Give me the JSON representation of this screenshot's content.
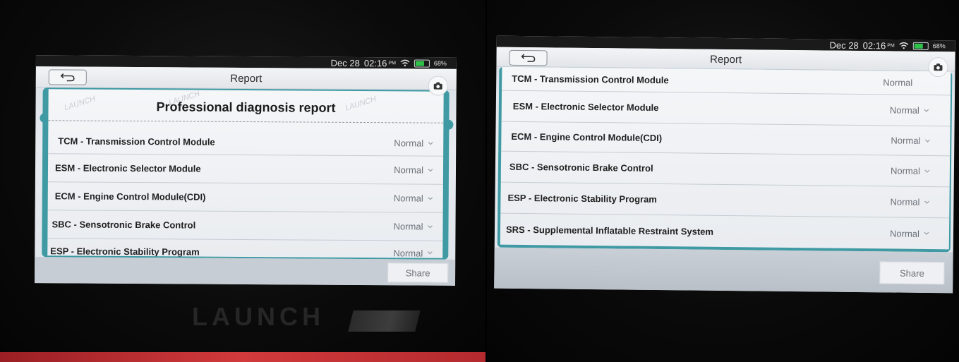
{
  "status": {
    "date": "Dec 28",
    "time": "02:16",
    "ampm": "PM",
    "battery": "68%"
  },
  "screen_title": "Report",
  "report_heading": "Professional diagnosis report",
  "watermark": "LAUNCH",
  "device_brand": "LAUNCH",
  "modules": [
    {
      "name": "TCM - Transmission Control Module",
      "status": "Normal"
    },
    {
      "name": "ESM - Electronic Selector Module",
      "status": "Normal"
    },
    {
      "name": "ECM - Engine Control Module(CDI)",
      "status": "Normal"
    },
    {
      "name": "SBC - Sensotronic Brake Control",
      "status": "Normal"
    },
    {
      "name": "ESP - Electronic Stability Program",
      "status": "Normal"
    },
    {
      "name": "SRS - Supplemental Inflatable Restraint System",
      "status": "Normal"
    }
  ],
  "share_label": "Share",
  "colors": {
    "accent": "#3f9aa4",
    "battery": "#2fc24a",
    "device_red": "#d23a3c"
  }
}
